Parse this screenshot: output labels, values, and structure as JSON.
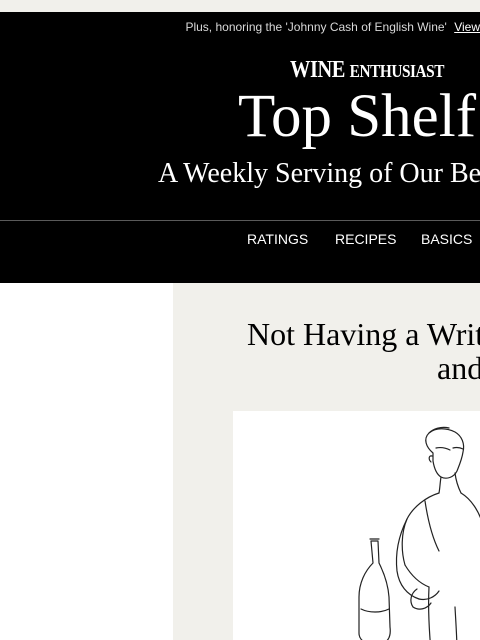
{
  "preheader": {
    "text": "Plus, honoring the 'Johnny Cash of English Wine'",
    "view_link": "View"
  },
  "brand": {
    "wine": "WINE",
    "enthusiast": "ENTHUSIAST"
  },
  "header": {
    "title": "Top Shelf",
    "subtitle": "A Weekly Serving of Our Be"
  },
  "nav": {
    "items": [
      "RATINGS",
      "RECIPES",
      "BASICS"
    ]
  },
  "article": {
    "headline_line1": "Not Having a Writ",
    "headline_line2": "and"
  },
  "colors": {
    "header_bg": "#000000",
    "content_bg": "#f1f0eb",
    "text_light": "#ffffff"
  }
}
